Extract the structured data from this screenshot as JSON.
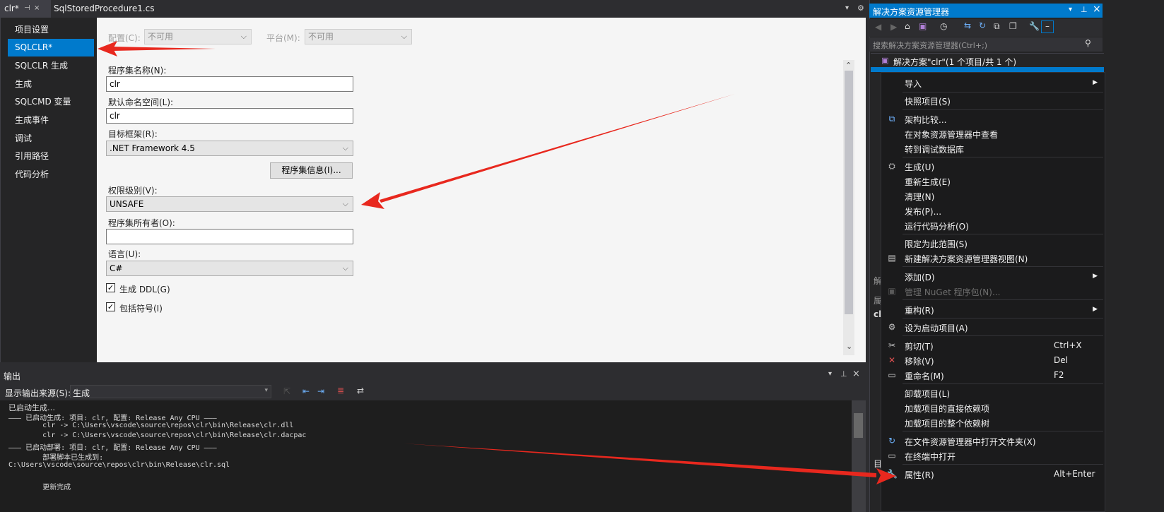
{
  "tabs": {
    "active": "clr*",
    "pin_glyph": "⊣",
    "close_glyph": "×",
    "other": "SqlStoredProcedure1.cs"
  },
  "left_nav": {
    "items": [
      "项目设置",
      "SQLCLR*",
      "SQLCLR 生成",
      "生成",
      "SQLCMD 变量",
      "生成事件",
      "调试",
      "引用路径",
      "代码分析"
    ],
    "selected_index": 1
  },
  "props": {
    "config_label": "配置(C):",
    "config_value": "不可用",
    "platform_label": "平台(M):",
    "platform_value": "不可用",
    "assembly_name_label": "程序集名称(N):",
    "assembly_name_value": "clr",
    "namespace_label": "默认命名空间(L):",
    "namespace_value": "clr",
    "framework_label": "目标框架(R):",
    "framework_value": ".NET Framework 4.5",
    "assembly_info_button": "程序集信息(I)...",
    "permission_label": "权限级别(V):",
    "permission_value": "UNSAFE",
    "owner_label": "程序集所有者(O):",
    "owner_value": "",
    "language_label": "语言(U):",
    "language_value": "C#",
    "ddl_label": "生成 DDL(G)",
    "ddl_checked": true,
    "symbols_label": "包括符号(I)",
    "symbols_checked": true
  },
  "output": {
    "title": "输出",
    "source_label": "显示输出来源(S):",
    "source_value": "生成",
    "lines": [
      "已启动生成…",
      "——— 已启动生成: 项目: clr, 配置: Release Any CPU ———",
      "        clr -> C:\\Users\\vscode\\source\\repos\\clr\\bin\\Release\\clr.dll",
      "        clr -> C:\\Users\\vscode\\source\\repos\\clr\\bin\\Release\\clr.dacpac",
      "——— 已启动部署: 项目: clr, 配置: Release Any CPU ———",
      "        部署脚本已生成到:",
      "C:\\Users\\vscode\\source\\repos\\clr\\bin\\Release\\clr.sql",
      "",
      "        更新完成"
    ]
  },
  "solution_explorer": {
    "title": "解决方案资源管理器",
    "search_placeholder": "搜索解决方案资源管理器(Ctrl+;)",
    "root": "解决方案\"clr\"(1 个项目/共 1 个)",
    "side_labels": [
      "解",
      "属",
      "cl",
      "目"
    ]
  },
  "context_menu": {
    "items": [
      {
        "label": "导入",
        "submenu": true
      },
      {
        "label": "快照项目(S)"
      },
      {
        "label": "架构比较...",
        "icon": "schema-compare-icon"
      },
      {
        "label": "在对象资源管理器中查看"
      },
      {
        "label": "转到调试数据库"
      },
      {
        "label": "生成(U)",
        "icon": "build-icon"
      },
      {
        "label": "重新生成(E)"
      },
      {
        "label": "清理(N)"
      },
      {
        "label": "发布(P)..."
      },
      {
        "label": "运行代码分析(O)"
      },
      {
        "label": "限定为此范围(S)"
      },
      {
        "label": "新建解决方案资源管理器视图(N)",
        "icon": "new-view-icon"
      },
      {
        "label": "添加(D)",
        "submenu": true
      },
      {
        "label": "管理 NuGet 程序包(N)...",
        "disabled": true,
        "icon": "nuget-icon"
      },
      {
        "label": "重构(R)",
        "submenu": true
      },
      {
        "label": "设为启动项目(A)",
        "icon": "gear-icon"
      },
      {
        "label": "剪切(T)",
        "shortcut": "Ctrl+X",
        "icon": "scissors-icon"
      },
      {
        "label": "移除(V)",
        "shortcut": "Del",
        "icon": "remove-icon"
      },
      {
        "label": "重命名(M)",
        "shortcut": "F2",
        "icon": "rename-icon"
      },
      {
        "label": "卸载项目(L)"
      },
      {
        "label": "加载项目的直接依赖项"
      },
      {
        "label": "加载项目的整个依赖树"
      },
      {
        "label": "在文件资源管理器中打开文件夹(X)",
        "icon": "refresh-open-icon"
      },
      {
        "label": "在终端中打开",
        "icon": "terminal-icon"
      },
      {
        "label": "属性(R)",
        "shortcut": "Alt+Enter",
        "icon": "wrench-icon"
      }
    ]
  },
  "colors": {
    "accent": "#007acc",
    "arrow": "#e8281e",
    "nav_selected": "#007acc"
  }
}
